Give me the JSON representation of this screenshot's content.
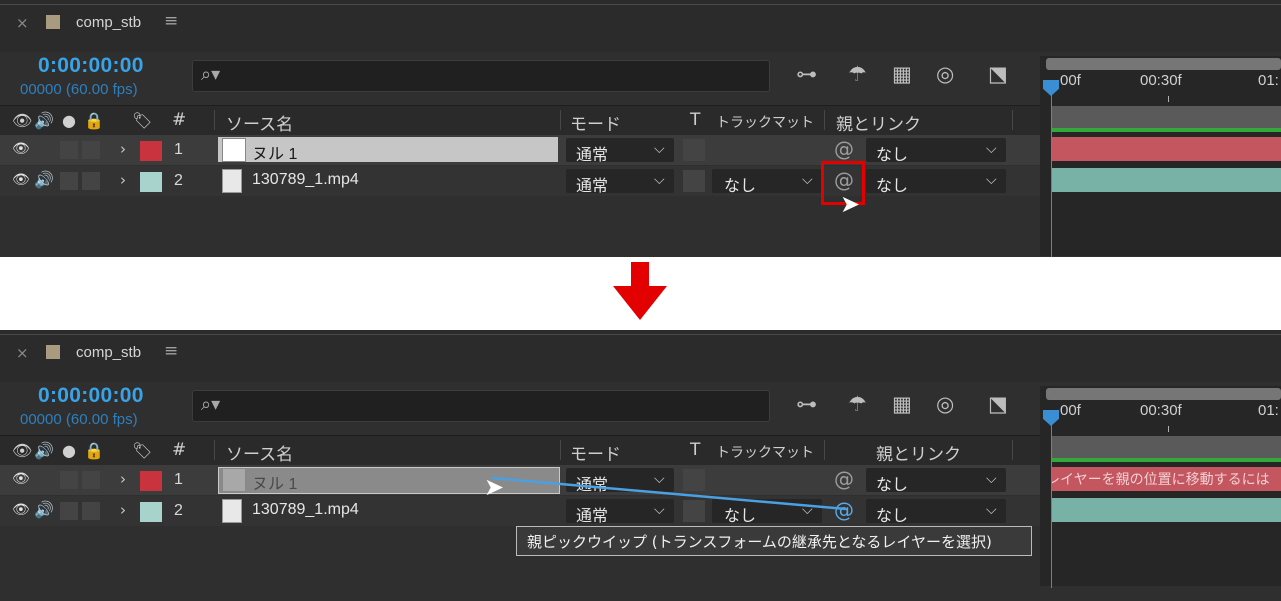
{
  "tab": {
    "close": "×",
    "title": "comp_stb",
    "menu": "≡"
  },
  "time": {
    "timecode": "0:00:00:00",
    "frames": "00000 (60.00 fps)"
  },
  "search": {
    "icon": "⌕▾"
  },
  "timeline": {
    "labels": [
      "00f",
      "00:30f",
      "01:"
    ]
  },
  "columns": {
    "tag": "#",
    "source_name": "ソース名",
    "mode": "モード",
    "t": "T",
    "track_matte": "トラックマット",
    "parent_link": "親とリンク"
  },
  "layers": [
    {
      "index": "1",
      "name": "ヌル 1",
      "mode": "通常",
      "matte": "",
      "parent": "なし",
      "label_color": "#c8333e",
      "timeline_color": "#c45660"
    },
    {
      "index": "2",
      "name": "130789_1.mp4",
      "mode": "通常",
      "matte": "なし",
      "parent": "なし",
      "label_color": "#a8d3cc",
      "timeline_color": "#78b1a6"
    }
  ],
  "timeline_hint": "レイヤーを親の位置に移動するには",
  "tooltip": "親ピックウイップ (トランスフォームの継承先となるレイヤーを選択)",
  "colors": {
    "accent": "#39a3e8",
    "highlight": "#e30000",
    "pickwhip_line": "#4aa0e0"
  }
}
